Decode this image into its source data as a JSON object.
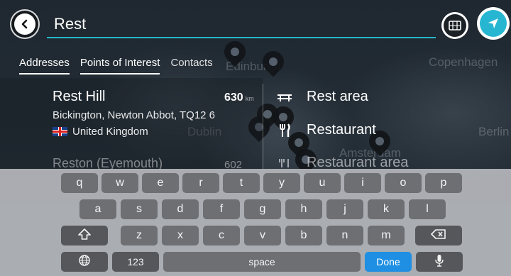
{
  "map": {
    "labels": [
      "Copenhagen",
      "Edinburgh",
      "Dublin",
      "Berlin",
      "Amsterdam"
    ]
  },
  "search": {
    "value": "Rest"
  },
  "tabs": [
    {
      "label": "Addresses"
    },
    {
      "label": "Points of Interest"
    },
    {
      "label": "Contacts"
    }
  ],
  "results": [
    {
      "title": "Rest Hill",
      "address": "Bickington, Newton Abbot, TQ12 6",
      "country": "United Kingdom",
      "distance": "630",
      "unit": "km"
    },
    {
      "title": "Reston (Eyemouth)",
      "distance": "602"
    }
  ],
  "categories": [
    {
      "label": "Rest area",
      "icon": "rest-area-icon"
    },
    {
      "label": "Restaurant",
      "icon": "fork-knife-icon"
    },
    {
      "label": "Restaurant area",
      "icon": "restaurant-area-icon"
    }
  ],
  "keyboard": {
    "row1": [
      "q",
      "w",
      "e",
      "r",
      "t",
      "y",
      "u",
      "i",
      "o",
      "p"
    ],
    "row2": [
      "a",
      "s",
      "d",
      "f",
      "g",
      "h",
      "j",
      "k",
      "l"
    ],
    "row3": [
      "z",
      "x",
      "c",
      "v",
      "b",
      "n",
      "m"
    ],
    "numbers_label": "123",
    "space_label": "space",
    "done_label": "Done"
  },
  "colors": {
    "accent": "#27b6d1",
    "done": "#1e8fe3"
  }
}
